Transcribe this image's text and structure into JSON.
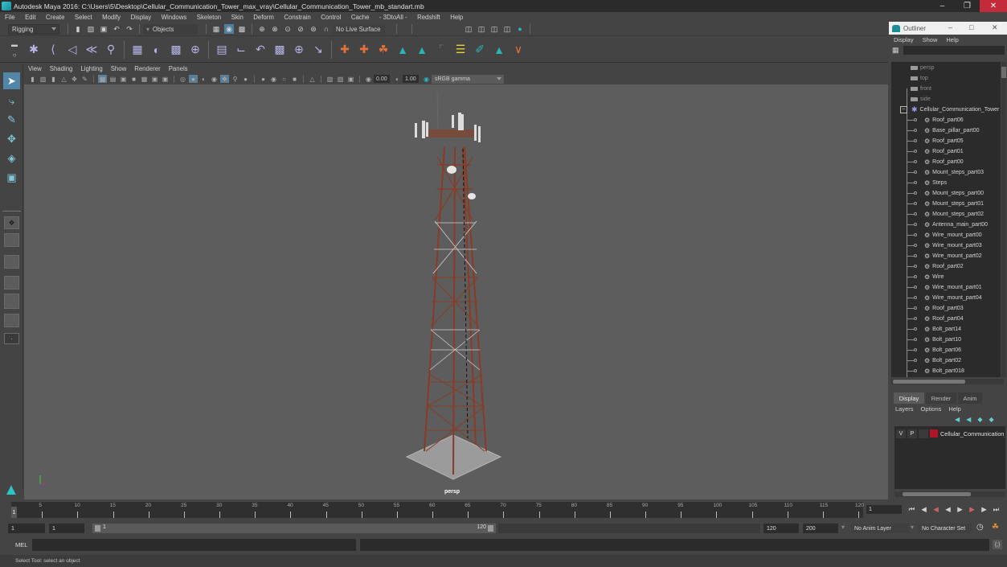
{
  "window": {
    "title": "Autodesk Maya 2016: C:\\Users\\5\\Desktop\\Cellular_Communication_Tower_max_vray\\Cellular_Communication_Tower_mb_standart.mb",
    "minimize": "–",
    "restore": "❐",
    "close": "✕"
  },
  "menubar": [
    "File",
    "Edit",
    "Create",
    "Select",
    "Modify",
    "Display",
    "Windows",
    "Skeleton",
    "Skin",
    "Deform",
    "Constrain",
    "Control",
    "Cache",
    "- 3DtoAll -",
    "Redshift",
    "Help"
  ],
  "statusline": {
    "menuset": "Rigging",
    "selection_mode": "Objects",
    "live_surface": "No Live Surface"
  },
  "viewport": {
    "menus": [
      "View",
      "Shading",
      "Lighting",
      "Show",
      "Renderer",
      "Panels"
    ],
    "exposure": "0.00",
    "gamma": "1.00",
    "color_space": "sRGB gamma",
    "camera_label": "persp"
  },
  "outliner": {
    "title": "Outliner",
    "menus": [
      "Display",
      "Show",
      "Help"
    ],
    "cameras": [
      "persp",
      "top",
      "front",
      "side"
    ],
    "root": "Cellular_Communication_Tower",
    "children": [
      "Roof_part06",
      "Base_pillar_part00",
      "Roof_part05",
      "Roof_part01",
      "Roof_part00",
      "Mount_steps_part03",
      "Steps",
      "Mount_steps_part00",
      "Mount_steps_part01",
      "Mount_steps_part02",
      "Antenna_main_part00",
      "Wire_mount_part00",
      "Wire_mount_part03",
      "Wire_mount_part02",
      "Roof_part02",
      "Wire",
      "Wire_mount_part01",
      "Wire_mount_part04",
      "Roof_part03",
      "Roof_part04",
      "Bolt_part14",
      "Bolt_part10",
      "Bolt_part06",
      "Bolt_part02",
      "Bolt_part018"
    ]
  },
  "layer_editor": {
    "tabs": [
      "Display",
      "Render",
      "Anim"
    ],
    "active_tab": "Display",
    "menus": [
      "Layers",
      "Options",
      "Help"
    ],
    "layer": {
      "v": "V",
      "p": "P",
      "name": "Cellular_Communication_Tower",
      "color": "#b0152a"
    }
  },
  "timeline": {
    "ticks": [
      "5",
      "10",
      "15",
      "20",
      "25",
      "30",
      "35",
      "40",
      "45",
      "50",
      "55",
      "60",
      "65",
      "70",
      "75",
      "80",
      "85",
      "90",
      "95",
      "100",
      "105",
      "110",
      "115",
      "120"
    ],
    "current_frame_marker": "1",
    "current_frame": "1",
    "range_start_outer": "1",
    "range_start_inner": "1",
    "range_bar_start": "1",
    "range_bar_end": "120",
    "range_end_inner": "120",
    "range_end_outer": "200",
    "anim_layer": "No Anim Layer",
    "character_set": "No Character Set"
  },
  "command_line": {
    "label": "MEL"
  },
  "help_line": "Select Tool: select an object"
}
